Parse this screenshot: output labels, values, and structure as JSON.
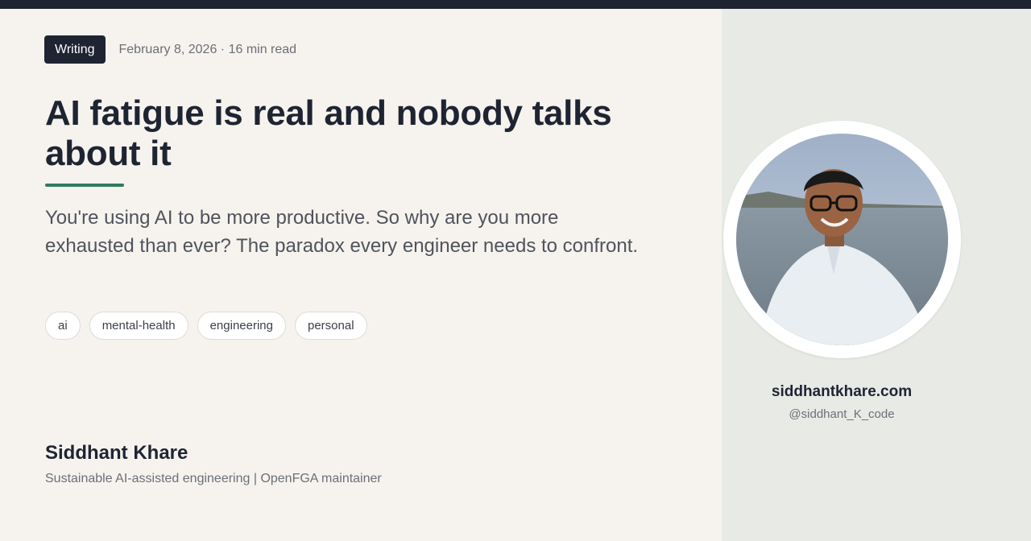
{
  "post": {
    "category": "Writing",
    "meta": "February 8, 2026 · 16 min read",
    "title": "AI fatigue is real and nobody talks about it",
    "subtitle": "You're using AI to be more productive. So why are you more exhausted than ever? The paradox every engineer needs to confront.",
    "tags": [
      "ai",
      "mental-health",
      "engineering",
      "personal"
    ]
  },
  "author": {
    "name": "Siddhant Khare",
    "bio": "Sustainable AI-assisted engineering | OpenFGA maintainer",
    "site": "siddhantkhare.com",
    "handle": "@siddhant_K_code"
  },
  "colors": {
    "dark": "#1f2433",
    "accent": "#2f7a62",
    "background": "#f6f3ee",
    "sidebar": "#e8eae6"
  },
  "icons": {
    "avatar": "author-photo"
  }
}
